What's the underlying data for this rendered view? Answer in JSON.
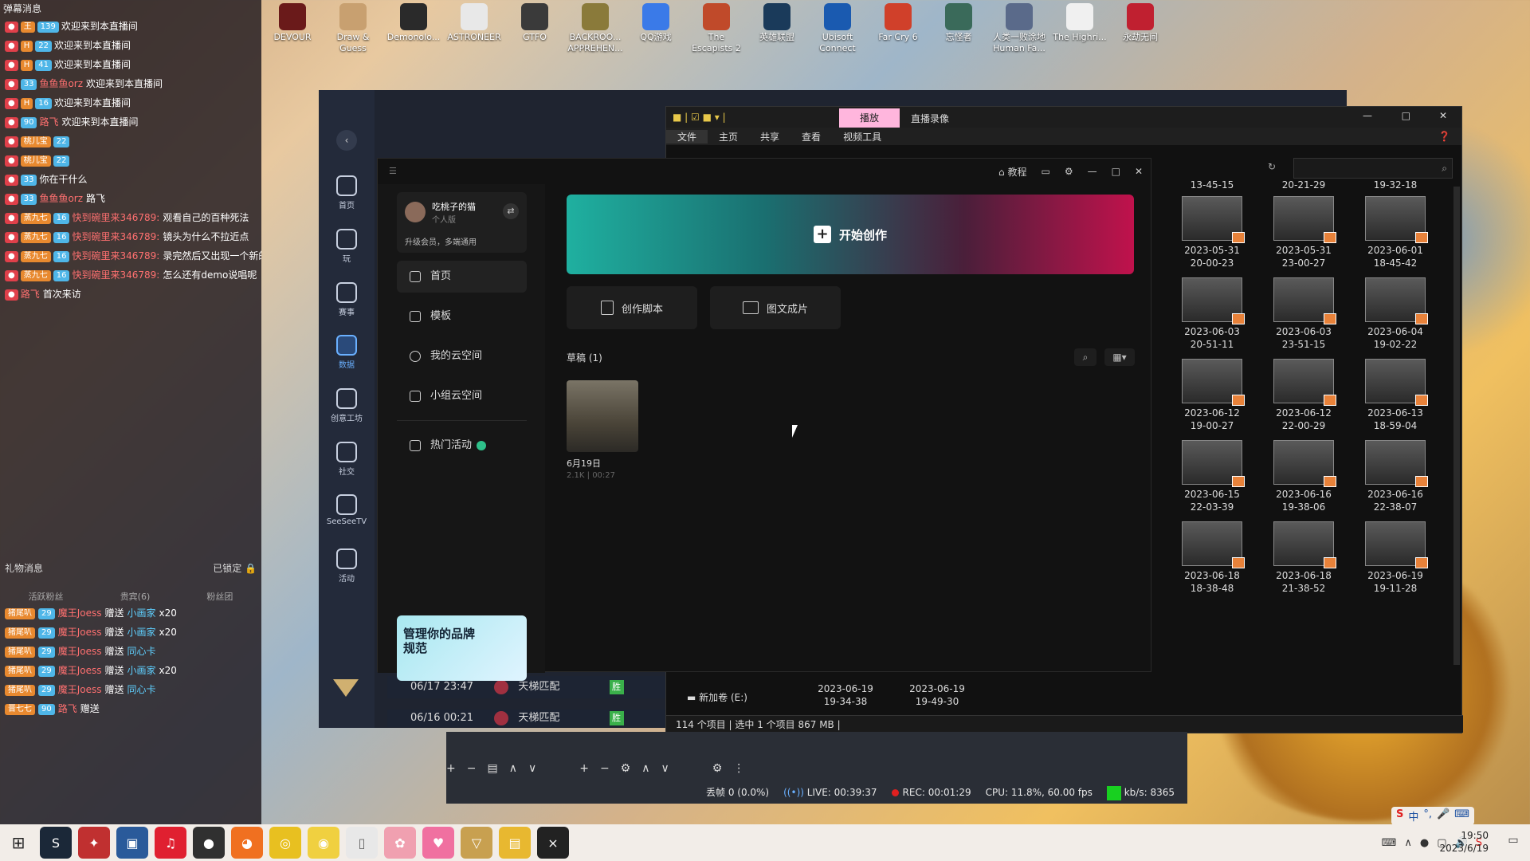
{
  "desktop": {
    "icons": [
      {
        "label": "DEVOUR",
        "color": "#6a1a1a"
      },
      {
        "label": "Draw & Guess",
        "color": "#c8a070"
      },
      {
        "label": "Demonolo...",
        "color": "#2a2a2a"
      },
      {
        "label": "ASTRONEER",
        "color": "#e8e8e8"
      },
      {
        "label": "GTFO",
        "color": "#3a3a3a"
      },
      {
        "label": "BACKROO... APPREHEN...",
        "color": "#8a7a3a"
      },
      {
        "label": "QQ游戏",
        "color": "#3a7ae8"
      },
      {
        "label": "The Escapists 2",
        "color": "#c04a2a"
      },
      {
        "label": "英雄联盟",
        "color": "#1a3a5a"
      },
      {
        "label": "Ubisoft Connect",
        "color": "#1a5ab0"
      },
      {
        "label": "Far Cry 6",
        "color": "#d0402a"
      },
      {
        "label": "忘怪者",
        "color": "#3a6a5a"
      },
      {
        "label": "人类一败涂地 Human Fa...",
        "color": "#5a6a8a"
      },
      {
        "label": "The Highri...",
        "color": "#f0f0f0"
      },
      {
        "label": "永劫无间",
        "color": "#c02030"
      }
    ]
  },
  "chat": {
    "header": "弹幕消息",
    "rows": [
      {
        "fan": "王",
        "lv": "139",
        "name": "",
        "msg": "欢迎来到本直播间"
      },
      {
        "fan": "H",
        "lv": "22",
        "name": "",
        "msg": "欢迎来到本直播间"
      },
      {
        "fan": "H",
        "lv": "41",
        "name": "",
        "msg": "欢迎来到本直播间"
      },
      {
        "fan": "",
        "lv": "33",
        "name": "鱼鱼鱼orz",
        "msg": "欢迎来到本直播间"
      },
      {
        "fan": "H",
        "lv": "16",
        "name": "",
        "msg": "欢迎来到本直播间"
      },
      {
        "fan": "",
        "lv": "90",
        "name": "路飞",
        "msg": "欢迎来到本直播间"
      },
      {
        "fan": "桃儿宝",
        "lv": "22",
        "name": "",
        "msg": ""
      },
      {
        "fan": "桃儿宝",
        "lv": "22",
        "name": "",
        "msg": ""
      },
      {
        "fan": "",
        "lv": "33",
        "name": "",
        "msg": "你在干什么"
      },
      {
        "fan": "",
        "lv": "33",
        "name": "鱼鱼鱼orz",
        "msg": "路飞"
      },
      {
        "fan": "蒸九七",
        "lv": "16",
        "name": "快到碗里来346789:",
        "msg": "观看自己的百种死法"
      },
      {
        "fan": "蒸九七",
        "lv": "16",
        "name": "快到碗里来346789:",
        "msg": "镜头为什么不拉近点"
      },
      {
        "fan": "蒸九七",
        "lv": "16",
        "name": "快到碗里来346789:",
        "msg": "录完然后又出现一个新的问题"
      },
      {
        "fan": "蒸九七",
        "lv": "16",
        "name": "快到碗里来346789:",
        "msg": "怎么还有demo说唱呢"
      },
      {
        "fan": "",
        "lv": "",
        "name": "路飞",
        "msg": "首次来访"
      }
    ],
    "gift_header": "礼物消息",
    "locked": "已锁定",
    "gift_tabs": [
      "活跃粉丝",
      "贵宾(6)",
      "粉丝团"
    ],
    "gifts": [
      {
        "fan": "猪尾叭",
        "lv": "29",
        "name": "魔王Joess",
        "action": "赠送",
        "item": "小画家",
        "count": "x20"
      },
      {
        "fan": "猪尾叭",
        "lv": "29",
        "name": "魔王Joess",
        "action": "赠送",
        "item": "小画家",
        "count": "x20"
      },
      {
        "fan": "猪尾叭",
        "lv": "29",
        "name": "魔王Joess",
        "action": "赠送",
        "item": "同心卡",
        "count": ""
      },
      {
        "fan": "猪尾叭",
        "lv": "29",
        "name": "魔王Joess",
        "action": "赠送",
        "item": "小画家",
        "count": "x20"
      },
      {
        "fan": "猪尾叭",
        "lv": "29",
        "name": "魔王Joess",
        "action": "赠送",
        "item": "同心卡",
        "count": ""
      },
      {
        "fan": "晋七七",
        "lv": "90",
        "name": "路飞",
        "action": "赠送",
        "item": "",
        "count": ""
      }
    ]
  },
  "obs_nav": [
    {
      "label": "首页"
    },
    {
      "label": "玩"
    },
    {
      "label": "赛事"
    },
    {
      "label": "数据"
    },
    {
      "label": "创意工坊"
    },
    {
      "label": "社交"
    },
    {
      "label": "SeeSeeTV"
    },
    {
      "label": "活动"
    }
  ],
  "explorer": {
    "quick_tab": "播放",
    "title": "直播录像",
    "ribbon": [
      "文件",
      "主页",
      "共享",
      "查看",
      "视频工具"
    ],
    "thumbs": [
      {
        "d": "13-45-15"
      },
      {
        "d": "20-21-29"
      },
      {
        "d": "19-32-18"
      },
      {
        "d": "2023-05-31\n20-00-23"
      },
      {
        "d": "2023-05-31\n23-00-27"
      },
      {
        "d": "2023-06-01\n18-45-42"
      },
      {
        "d": "2023-06-03\n20-51-11"
      },
      {
        "d": "2023-06-03\n23-51-15"
      },
      {
        "d": "2023-06-04\n19-02-22"
      },
      {
        "d": "2023-06-12\n19-00-27"
      },
      {
        "d": "2023-06-12\n22-00-29"
      },
      {
        "d": "2023-06-13\n18-59-04"
      },
      {
        "d": "2023-06-15\n22-03-39"
      },
      {
        "d": "2023-06-16\n19-38-06"
      },
      {
        "d": "2023-06-16\n22-38-07"
      },
      {
        "d": "2023-06-18\n18-38-48"
      },
      {
        "d": "2023-06-18\n21-38-52"
      },
      {
        "d": "2023-06-19\n19-11-28"
      }
    ],
    "bottom_thumbs": [
      {
        "d": "2023-06-19\n19-34-38"
      },
      {
        "d": "2023-06-19\n19-49-30"
      }
    ],
    "drive": "新加卷 (E:)",
    "status": "114 个项目  |  选中 1 个项目  867 MB  |"
  },
  "app": {
    "tutorial": "教程",
    "user_name": "吃桃子的猫",
    "user_tier": "个人版",
    "upgrade": "升级会员，多端通用",
    "nav": [
      "首页",
      "模板",
      "我的云空间",
      "小组云空间",
      "热门活动"
    ],
    "banner": "管理你的品牌规范",
    "create_label": "开始创作",
    "script_label": "创作脚本",
    "imgvid_label": "图文成片",
    "drafts_label": "草稿 (1)",
    "draft_title": "6月19日",
    "draft_meta": "2.1K | 00:27"
  },
  "matches": [
    {
      "date": "06/17 23:47",
      "mode": "天梯匹配",
      "result": "胜"
    },
    {
      "date": "06/16 00:21",
      "mode": "天梯匹配",
      "result": "胜"
    }
  ],
  "obs_status": {
    "dropped": "丢帧 0 (0.0%)",
    "live": "LIVE: 00:39:37",
    "rec": "REC: 00:01:29",
    "cpu": "CPU: 11.8%, 60.00 fps",
    "kbs": "kb/s: 8365"
  },
  "ime": {
    "lang": "中"
  },
  "clock": {
    "time": "19:50",
    "date": "2023/6/19"
  }
}
